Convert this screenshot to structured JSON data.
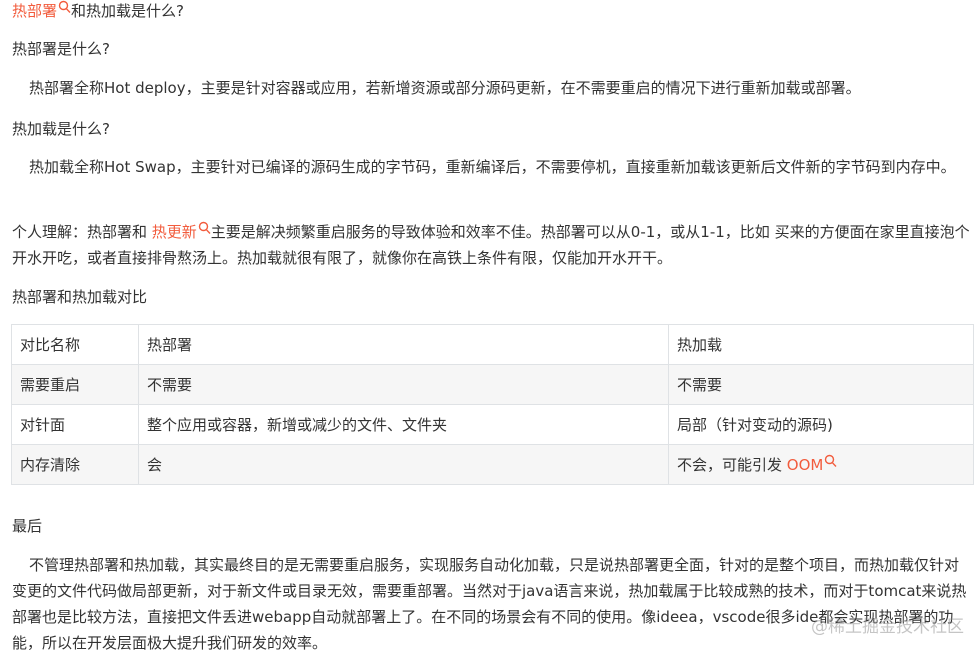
{
  "title": {
    "keyword": "热部署",
    "rest": "和热加载是什么?"
  },
  "q1": "热部署是什么?",
  "p1": "热部署全称Hot deploy，主要是针对容器或应用，若新增资源或部分源码更新，在不需要重启的情况下进行重新加载或部署。",
  "q2": "热加载是什么?",
  "p2": "热加载全称Hot Swap，主要针对已编译的源码生成的字节码，重新编译后，不需要停机，直接重新加载该更新后文件新的字节码到内存中。",
  "p3": {
    "before": "个人理解：热部署和 ",
    "keyword": "热更新",
    "after": "主要是解决频繁重启服务的导致体验和效率不佳。热部署可以从0-1，或从1-1，比如 买来的方便面在家里直接泡个开水开吃，或者直接排骨熬汤上。热加载就很有限了，就像你在高铁上条件有限，仅能加开水开干。"
  },
  "q3": "热部署和热加载对比",
  "table": {
    "header": [
      "对比名称",
      "热部署",
      "热加载"
    ],
    "rows": [
      [
        "需要重启",
        "不需要",
        "不需要"
      ],
      [
        "对针面",
        "整个应用或容器，新增或减少的文件、文件夹",
        "局部（针对变动的源码)"
      ],
      [
        "内存清除",
        "会",
        "不会，可能引发 "
      ]
    ],
    "oom_keyword": "OOM"
  },
  "q4": "最后",
  "p4": "不管理热部署和热加载，其实最终目的是无需要重启服务，实现服务自动化加载，只是说热部署更全面，针对的是整个项目，而热加载仅针对变更的文件代码做局部更新，对于新文件或目录无效，需要重部署。当然对于java语言来说，热加载属于比较成熟的技术，而对于tomcat来说热部署也是比较方法，直接把文件丢进webapp自动就部署上了。在不同的场景会有不同的使用。像ideea，vscode很多ide都会实现热部署的功能，所以在开发层面极大提升我们研发的效率。",
  "watermark": "@稀土掘金技术社区",
  "colors": {
    "keyword": "#f25c3d",
    "text": "#333333",
    "table_border": "#dfe2e5",
    "row_alt": "#f6f6f6"
  }
}
